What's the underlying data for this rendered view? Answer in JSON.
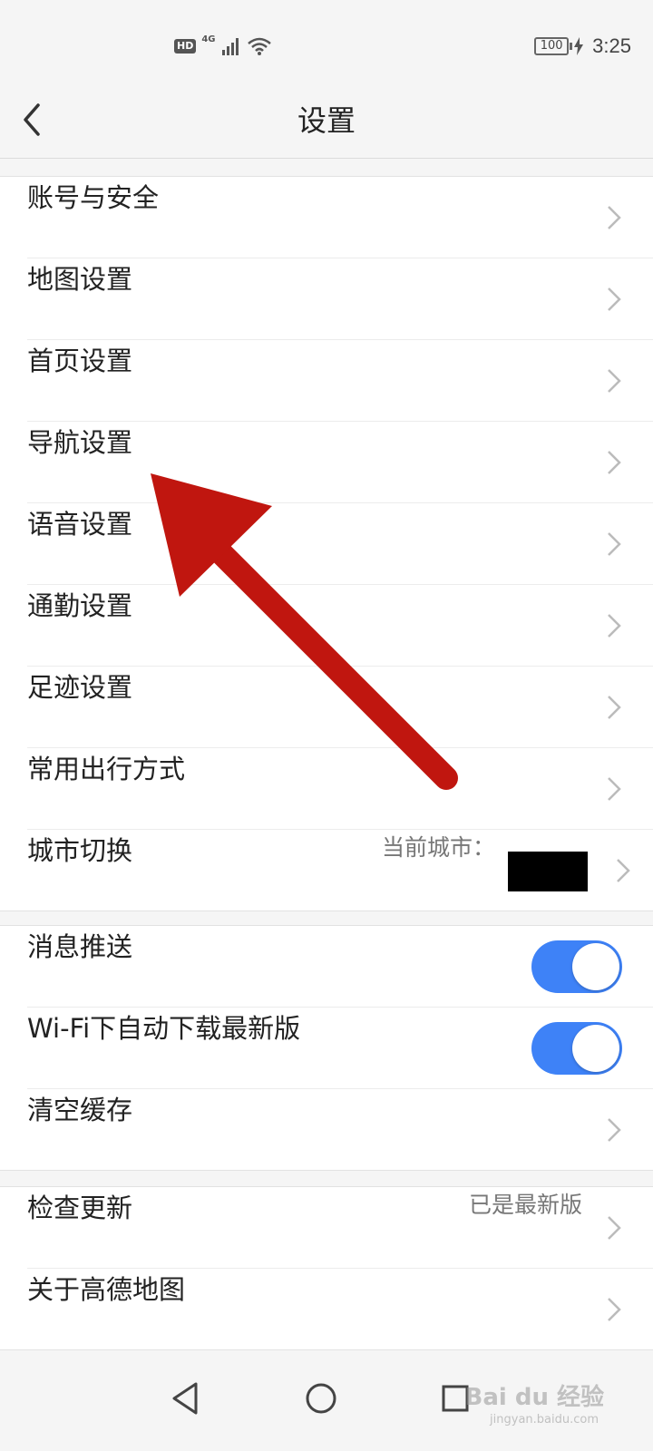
{
  "status_bar": {
    "hd": "HD",
    "network": "4G",
    "battery": "100",
    "time": "3:25"
  },
  "header": {
    "title": "设置"
  },
  "group1": [
    {
      "label": "账号与安全"
    },
    {
      "label": "地图设置"
    },
    {
      "label": "首页设置"
    },
    {
      "label": "导航设置"
    },
    {
      "label": "语音设置"
    },
    {
      "label": "通勤设置"
    },
    {
      "label": "足迹设置"
    },
    {
      "label": "常用出行方式"
    },
    {
      "label": "城市切换",
      "value": "当前城市："
    }
  ],
  "group2": [
    {
      "label": "消息推送",
      "toggle_on": true
    },
    {
      "label": "Wi-Fi下自动下载最新版",
      "toggle_on": true
    },
    {
      "label": "清空缓存"
    }
  ],
  "group3": [
    {
      "label": "检查更新",
      "value": "已是最新版"
    },
    {
      "label": "关于高德地图"
    }
  ],
  "watermark": {
    "brand": "Bai du 经验",
    "url": "jingyan.baidu.com"
  },
  "colors": {
    "toggle_on": "#3e82f7",
    "annotation_arrow": "#c0160f"
  }
}
